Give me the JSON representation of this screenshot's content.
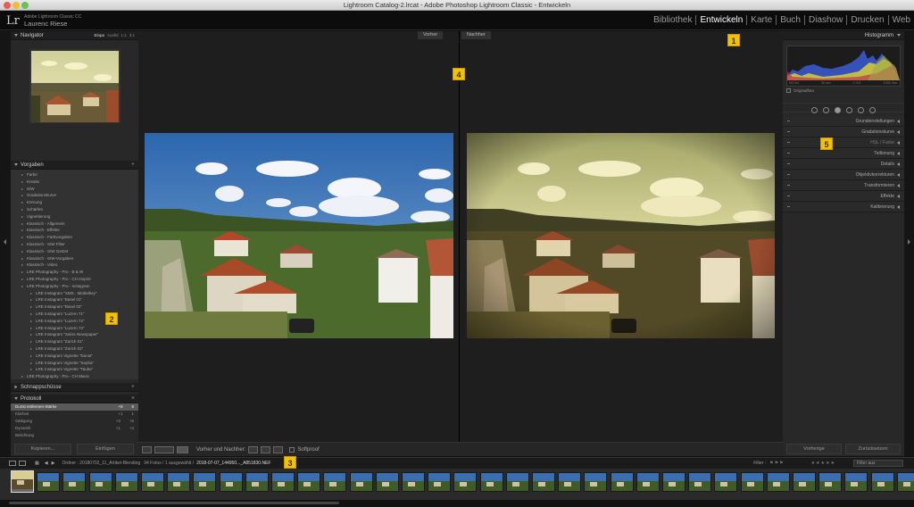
{
  "window": {
    "title": "Lightroom Catalog-2.lrcat - Adobe Photoshop Lightroom Classic - Entwickeln"
  },
  "brand": {
    "logo": "Lr",
    "product": "Adobe Lightroom Classic CC",
    "user": "Laurenc Riese"
  },
  "modules": [
    "Bibliothek",
    "Entwickeln",
    "Karte",
    "Buch",
    "Diashow",
    "Drucken",
    "Web"
  ],
  "active_module": "Entwickeln",
  "navigator": {
    "title": "Navigator",
    "zoom_options": [
      "Einpa",
      "Ausfül",
      "1:1",
      "3:1"
    ]
  },
  "presets": {
    "title": "Vorgaben",
    "items": [
      {
        "label": "Farbe",
        "level": "top"
      },
      {
        "label": "Kreativ",
        "level": "top"
      },
      {
        "label": "S/W",
        "level": "top"
      },
      {
        "label": "Gradationskurve",
        "level": "top"
      },
      {
        "label": "Körnung",
        "level": "top"
      },
      {
        "label": "Schärfen",
        "level": "top"
      },
      {
        "label": "Vignettierung",
        "level": "top"
      },
      {
        "label": "Klassisch - Allgemein",
        "level": "top"
      },
      {
        "label": "Klassisch - Effekte",
        "level": "top"
      },
      {
        "label": "Klassisch - Farbvorgaben",
        "level": "top"
      },
      {
        "label": "Klassisch - S/W Filter",
        "level": "top"
      },
      {
        "label": "Klassisch - S/W Getönt",
        "level": "top"
      },
      {
        "label": "Klassisch - S/W-Vorgaben",
        "level": "top"
      },
      {
        "label": "Klassisch - Video",
        "level": "top"
      },
      {
        "label": "LRE Photography - Pro - B & W",
        "level": "top"
      },
      {
        "label": "LRE Photography - Pro - CH Inspire",
        "level": "top"
      },
      {
        "label": "LRE Photography - Pro - Instagram",
        "level": "top"
      },
      {
        "label": "LRE Instagram \"XMS - Middelkey\"",
        "level": "sub"
      },
      {
        "label": "LRE Instagram \"Basel 01\"",
        "level": "sub"
      },
      {
        "label": "LRE Instagram \"Basel 02\"",
        "level": "sub"
      },
      {
        "label": "LRE Instagram \"Luzern 71\"",
        "level": "sub"
      },
      {
        "label": "LRE Instagram \"Luzern 72\"",
        "level": "sub"
      },
      {
        "label": "LRE Instagram \"Luzern 73\"",
        "level": "sub"
      },
      {
        "label": "LRE Instagram \"Swiss Newspaper\"",
        "level": "sub"
      },
      {
        "label": "LRE Instagram \"Zürich 01\"",
        "level": "sub"
      },
      {
        "label": "LRE Instagram \"Zürich 02\"",
        "level": "sub"
      },
      {
        "label": "LRE Instagram Vignette \"Dunst\"",
        "level": "sub"
      },
      {
        "label": "LRE Instagram Vignette \"Sepha\"",
        "level": "sub"
      },
      {
        "label": "LRE Instagram Vignette \"Taube\"",
        "level": "sub"
      },
      {
        "label": "LRE Photography - Pro - CH Mavic",
        "level": "top"
      }
    ]
  },
  "snapshots": {
    "title": "Schnappschüsse"
  },
  "history": {
    "title": "Protokoll",
    "items": [
      {
        "label": "Dunst entfernen-Stärke",
        "delta": "+8",
        "value": "8",
        "selected": true
      },
      {
        "label": "Klarheit",
        "delta": "+1",
        "value": "1",
        "selected": false
      },
      {
        "label": "Sättigung",
        "delta": "+3",
        "value": "+5",
        "selected": false
      },
      {
        "label": "Dynamik",
        "delta": "+1",
        "value": "+2",
        "selected": false
      },
      {
        "label": "Belichtung",
        "delta": "",
        "value": "",
        "selected": false
      }
    ]
  },
  "left_buttons": {
    "copy": "Kopieren...",
    "paste": "Einfügen"
  },
  "view_labels": {
    "before": "Vorher",
    "after": "Nachher"
  },
  "toolbar": {
    "mode": "Vorher und Nachher:",
    "softproof": "Softproof"
  },
  "filmstrip_header": {
    "source": "Ordner : 20180702_11_Artikel-Blending",
    "count": "94 Fotos / 1 ausgewählt /",
    "file": "2018-07-07_144950..._A851830.NEF",
    "filter_label": "Filter :",
    "filter_value": "Filter aus"
  },
  "histogram": {
    "title": "Histogramm",
    "iso": "ISO 64",
    "focal": "35 mm",
    "aperture": "f / 5,6",
    "shutter": "1/250 Sek.",
    "original_label": "Originalfoto"
  },
  "right_sections": [
    {
      "label": "Grundeinstellungen",
      "dim": false
    },
    {
      "label": "Gradationskurve",
      "dim": false
    },
    {
      "label": "HSL / Farbe",
      "dim": true
    },
    {
      "label": "Teiltonung",
      "dim": false
    },
    {
      "label": "Details",
      "dim": false
    },
    {
      "label": "Objektivkorrekturen",
      "dim": false
    },
    {
      "label": "Transformieren",
      "dim": false
    },
    {
      "label": "Effekte",
      "dim": false
    },
    {
      "label": "Kalibrierung",
      "dim": false
    }
  ],
  "right_buttons": {
    "previous": "Vorherige",
    "reset": "Zurücksetzen"
  },
  "badges": [
    "1",
    "2",
    "3",
    "4",
    "5"
  ],
  "colors": {
    "badge": "#f5c000",
    "panel": "#282828",
    "center_bg": "#1e1e1e"
  }
}
